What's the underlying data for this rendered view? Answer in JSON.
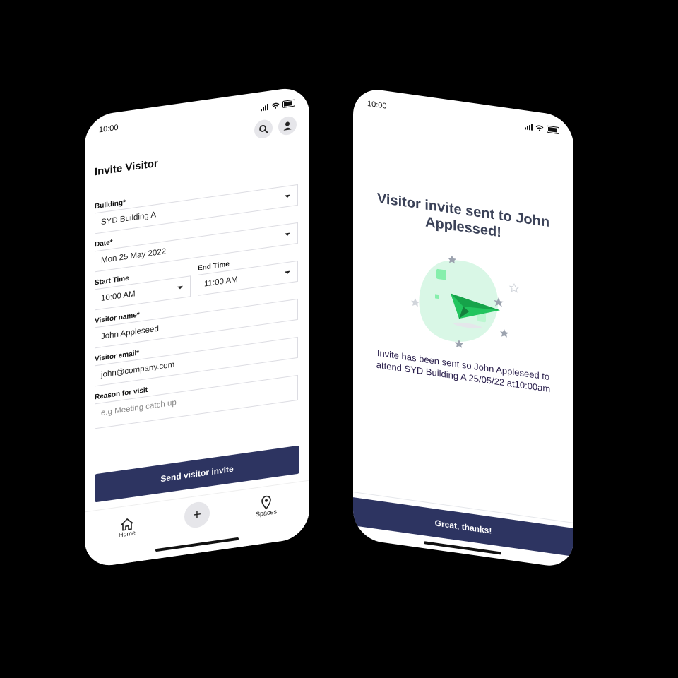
{
  "invite_screen": {
    "status_time": "10:00",
    "title": "Invite Visitor",
    "building": {
      "label": "Building*",
      "value": "SYD Building A"
    },
    "date": {
      "label": "Date*",
      "value": "Mon 25 May 2022"
    },
    "start_time": {
      "label": "Start Time",
      "value": "10:00 AM"
    },
    "end_time": {
      "label": "End Time",
      "value": "11:00 AM"
    },
    "visitor_name": {
      "label": "Visitor name*",
      "value": "John Appleseed"
    },
    "visitor_email": {
      "label": "Visitor email*",
      "value": "john@company.com"
    },
    "reason": {
      "label": "Reason for visit",
      "placeholder": "e.g Meeting catch up"
    },
    "submit_label": "Send visitor invite",
    "nav": {
      "home": "Home",
      "add": "+",
      "spaces": "Spaces"
    }
  },
  "confirm_screen": {
    "status_time": "10:00",
    "heading": "Visitor invite sent to John Applessed!",
    "message": "Invite has been sent so John Appleseed to attend SYD Building A 25/05/22 at10:00am",
    "button_label": "Great, thanks!"
  },
  "colors": {
    "primary": "#2d3461",
    "accent_green": "#22c55e",
    "blob": "#d9f7e6",
    "text_dark": "#3b4258"
  }
}
